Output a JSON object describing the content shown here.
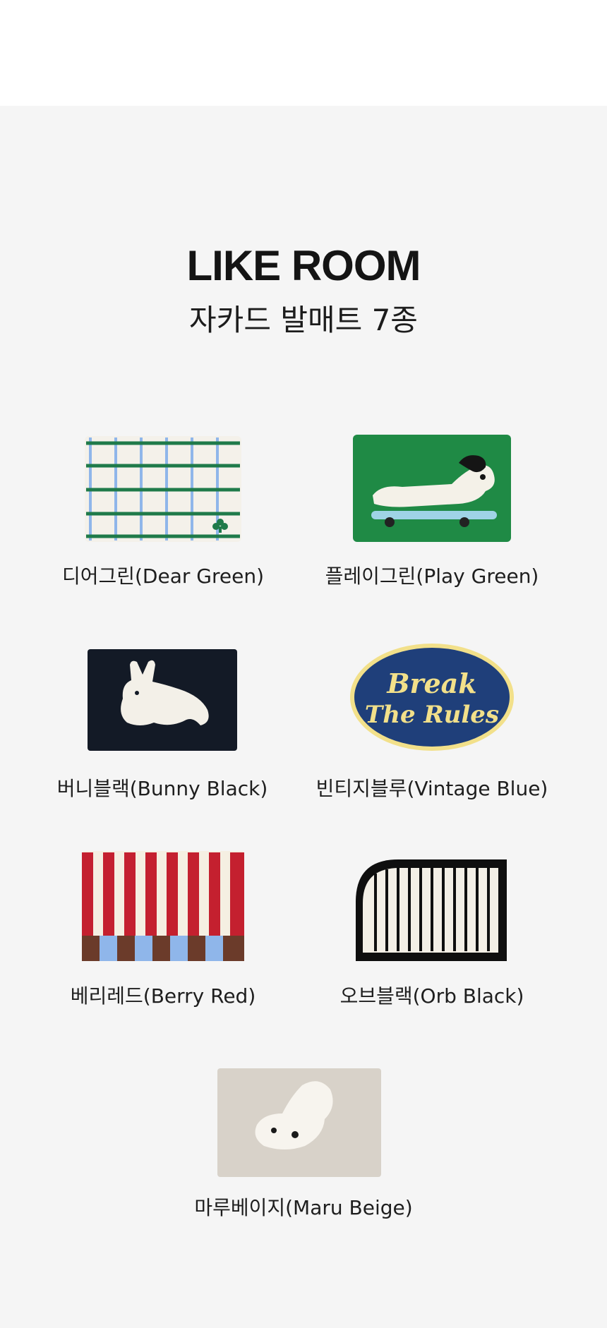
{
  "header": {
    "brand": "LIKE ROOM",
    "subtitle": "자카드 발매트 7종"
  },
  "products": [
    {
      "label": "디어그린(Dear Green)",
      "icon": "grid-pattern-rug"
    },
    {
      "label": "플레이그린(Play Green)",
      "icon": "skateboard-dog-rug"
    },
    {
      "label": "버니블랙(Bunny Black)",
      "icon": "bunny-rug"
    },
    {
      "label": "빈티지블루(Vintage Blue)",
      "icon": "break-the-rules-oval-rug",
      "rug_text_line1": "Break",
      "rug_text_line2": "The Rules"
    },
    {
      "label": "베리레드(Berry Red)",
      "icon": "red-stripe-rug"
    },
    {
      "label": "오브블랙(Orb Black)",
      "icon": "black-white-stripe-rug"
    },
    {
      "label": "마루베이지(Maru Beige)",
      "icon": "beige-puppy-rug"
    }
  ],
  "colors": {
    "panel_bg": "#f5f5f5",
    "dear_green_line": "#1f7a4a",
    "dear_blue_line": "#8fb6ea",
    "play_green": "#1f8a45",
    "vintage_navy": "#1f3f7a",
    "vintage_yellow": "#f2e08a",
    "berry_red": "#c4202f",
    "maru_beige": "#d8d2c9"
  }
}
